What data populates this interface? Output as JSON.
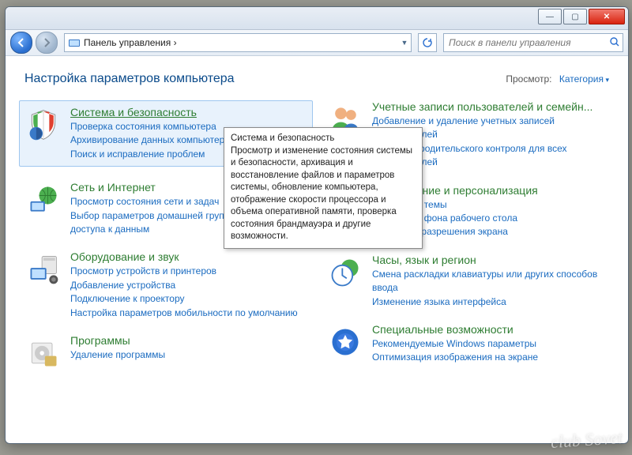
{
  "window": {
    "breadcrumb": "Панель управления  ›",
    "search_placeholder": "Поиск в панели управления"
  },
  "header": {
    "title": "Настройка параметров компьютера",
    "view_label": "Просмотр:",
    "view_value": "Категория"
  },
  "left": [
    {
      "id": "system-security",
      "title": "Система и безопасность",
      "links": [
        "Проверка состояния компьютера",
        "Архивирование данных компьютера",
        "Поиск и исправление проблем"
      ],
      "highlight": true
    },
    {
      "id": "network",
      "title": "Сеть и Интернет",
      "links": [
        "Просмотр состояния сети и задач",
        "Выбор параметров домашней группы и общего доступа к данным"
      ]
    },
    {
      "id": "hardware",
      "title": "Оборудование и звук",
      "links": [
        "Просмотр устройств и принтеров",
        "Добавление устройства",
        "Подключение к проектору",
        "Настройка параметров мобильности по умолчанию"
      ]
    },
    {
      "id": "programs",
      "title": "Программы",
      "links": [
        "Удаление программы"
      ]
    }
  ],
  "right": [
    {
      "id": "users",
      "title": "Учетные записи пользователей и семейн...",
      "links": [
        "Добавление и удаление учетных записей пользователей",
        "Установка родительского контроля для всех пользователей"
      ]
    },
    {
      "id": "appearance",
      "title": "Оформление и персонализация",
      "links": [
        "Изменение темы",
        "Изменение фона рабочего стола",
        "Настройка разрешения экрана"
      ]
    },
    {
      "id": "clock",
      "title": "Часы, язык и регион",
      "links": [
        "Смена раскладки клавиатуры или других способов ввода",
        "Изменение языка интерфейса"
      ]
    },
    {
      "id": "ease",
      "title": "Специальные возможности",
      "links": [
        "Рекомендуемые Windows параметры",
        "Оптимизация изображения на экране"
      ]
    }
  ],
  "tooltip": {
    "title": "Система и безопасность",
    "body": "Просмотр и изменение состояния системы и безопасности, архивация и восстановление файлов и параметров системы, обновление компьютера, отображение скорости процессора и объема оперативной памяти, проверка состояния брандмауэра и другие возможности."
  },
  "watermark": "club Sovet"
}
